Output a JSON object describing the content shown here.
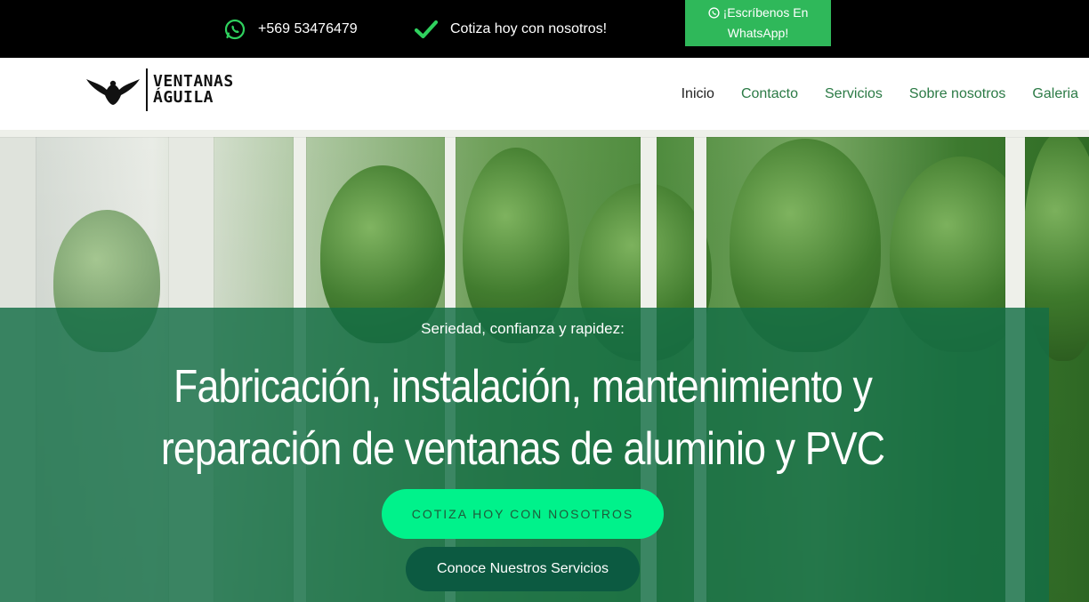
{
  "topbar": {
    "phone": "+569 53476479",
    "cotiza_text": "Cotiza hoy con nosotros!",
    "whatsapp_button": "¡Escríbenos En WhatsApp!",
    "icons": {
      "phone": "whatsapp-icon",
      "cotiza": "check-icon",
      "button": "whatsapp-icon"
    }
  },
  "header": {
    "logo_line1": "VENTANAS",
    "logo_line2": "ÁGUILA",
    "nav": [
      "Inicio",
      "Contacto",
      "Servicios",
      "Sobre nosotros",
      "Galeria"
    ],
    "active_nav": "Inicio"
  },
  "hero": {
    "subtitle": "Seriedad, confianza y rapidez:",
    "title": "Fabricación, instalación, mantenimiento y reparación de ventanas de aluminio y PVC",
    "primary_button": "COTIZA HOY CON NOSOTROS",
    "secondary_button": "Conoce Nuestros Servicios"
  },
  "colors": {
    "topbar_bg": "#000000",
    "whatsapp_green": "#2fb85a",
    "nav_green": "#2b7a45",
    "hero_overlay": "#146e46",
    "primary_button": "#00f28b",
    "secondary_button": "#0c5a41"
  }
}
